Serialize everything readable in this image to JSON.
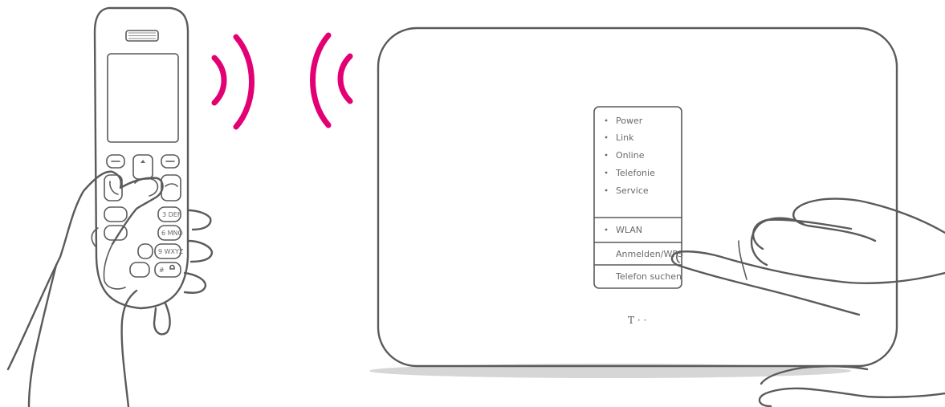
{
  "colors": {
    "outline": "#5a5a5a",
    "signal": "#e20074",
    "shadow": "#d6d6d6"
  },
  "router": {
    "status_leds": [
      "Power",
      "Link",
      "Online",
      "Telefonie",
      "Service"
    ],
    "wlan_label": "WLAN",
    "buttons": [
      "Anmelden/WPS",
      "Telefon suchen"
    ],
    "logo": "T · ·"
  },
  "phone": {
    "keys": [
      "3 DEF",
      "6 MNO",
      "9 WXYZ",
      "#"
    ]
  },
  "icons": {
    "signal_out": "wireless-signal-icon",
    "signal_in": "wireless-signal-icon"
  }
}
